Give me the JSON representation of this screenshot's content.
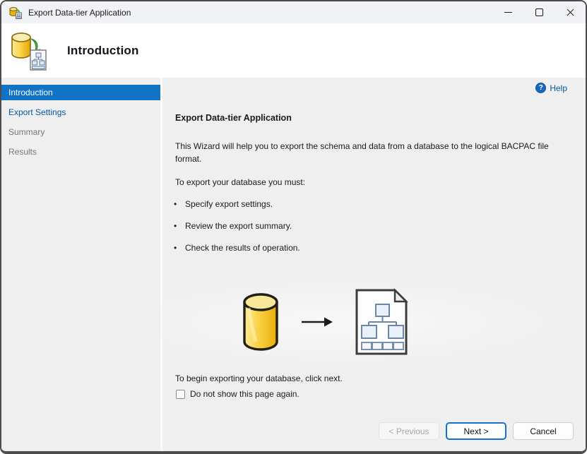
{
  "window": {
    "title": "Export Data-tier Application"
  },
  "header": {
    "title": "Introduction"
  },
  "sidebar": {
    "items": [
      {
        "label": "Introduction",
        "state": "selected"
      },
      {
        "label": "Export Settings",
        "state": "link"
      },
      {
        "label": "Summary",
        "state": "disabled"
      },
      {
        "label": "Results",
        "state": "disabled"
      }
    ]
  },
  "content": {
    "help_label": "Help",
    "heading": "Export Data-tier Application",
    "intro": "This Wizard will help you to export the schema and data from a database to the logical BACPAC file format.",
    "requirements_intro": "To export your database you must:",
    "bullets": [
      "Specify export settings.",
      "Review the export summary.",
      "Check the results of operation."
    ],
    "closing": "To begin exporting your database, click next.",
    "checkbox_label": "Do not show this page again.",
    "checkbox_checked": false
  },
  "footer": {
    "previous_label": "< Previous",
    "next_label": "Next >",
    "cancel_label": "Cancel"
  },
  "icons": {
    "app": "database-export-icon",
    "header": "database-to-bacpac-icon",
    "help_glyph": "?",
    "graphic": [
      "database-cylinder-icon",
      "arrow-right-icon",
      "bacpac-document-icon"
    ]
  },
  "colors": {
    "accent_blue": "#1173c5",
    "link_blue": "#0257a8",
    "titlebar_bg": "#f1f2f6",
    "content_bg": "#efefef",
    "next_button_border": "#1273cf",
    "database_yellow": "#fbd34b"
  }
}
